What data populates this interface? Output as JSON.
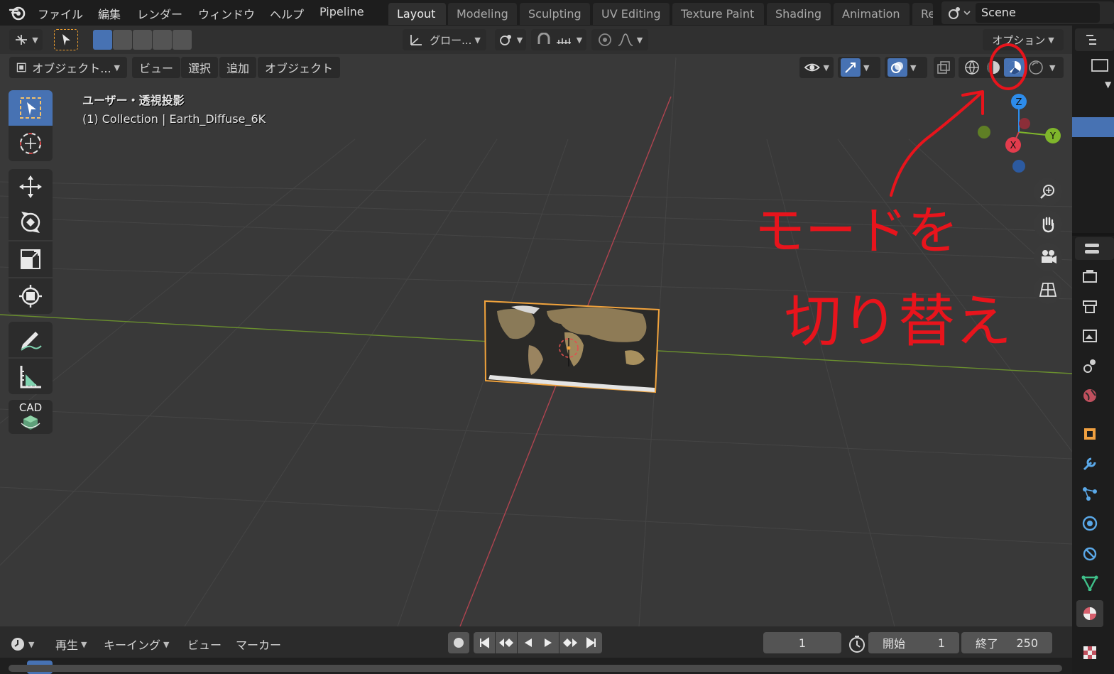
{
  "menubar": {
    "items": [
      "ファイル",
      "編集",
      "レンダー",
      "ウィンドウ",
      "ヘルプ",
      "Pipeline"
    ]
  },
  "workspaces": {
    "tabs": [
      "Layout",
      "Modeling",
      "Sculpting",
      "UV Editing",
      "Texture Paint",
      "Shading",
      "Animation",
      "Re"
    ],
    "active": "Layout"
  },
  "scene": {
    "label": "Scene"
  },
  "toolheader": {
    "orientation": "グロー...",
    "options": "オプション"
  },
  "viewport_header": {
    "mode": "オブジェクト...",
    "menus": [
      "ビュー",
      "選択",
      "追加",
      "オブジェクト"
    ]
  },
  "viewport": {
    "view_name": "ユーザー・透視投影",
    "collection_info": "(1) Collection | Earth_Diffuse_6K"
  },
  "gizmo": {
    "z": "Z",
    "y": "Y",
    "x": "X"
  },
  "toolbar": {
    "cad_label": "CAD"
  },
  "annotation": {
    "line1": "モードを",
    "line2": "切り替え",
    "color": "#e8141c"
  },
  "timeline": {
    "playback": "再生",
    "keying": "キーイング",
    "view": "ビュー",
    "marker": "マーカー",
    "current_frame": "1",
    "start_label": "開始",
    "start_value": "1",
    "end_label": "終了",
    "end_value": "250"
  },
  "colors": {
    "accent": "#4772b3",
    "selection_outline": "#f1a33c",
    "x_axis": "#d4424e",
    "y_axis": "#7fb62b",
    "z_axis": "#2d8ceb"
  }
}
